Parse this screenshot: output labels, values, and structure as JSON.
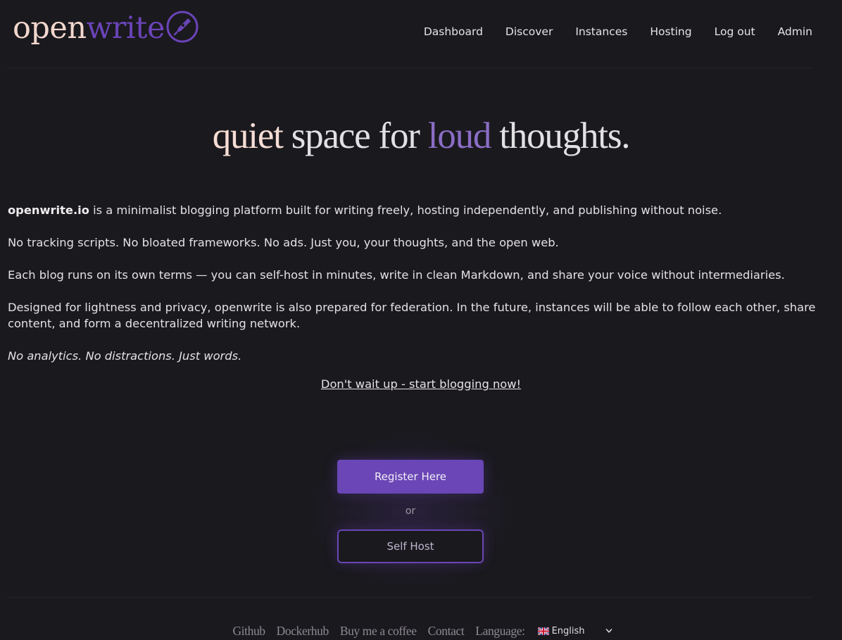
{
  "header": {
    "logo_open": "open",
    "logo_write": "write",
    "nav": [
      {
        "label": "Dashboard"
      },
      {
        "label": "Discover"
      },
      {
        "label": "Instances"
      },
      {
        "label": "Hosting"
      },
      {
        "label": "Log out"
      },
      {
        "label": "Admin"
      }
    ]
  },
  "hero": {
    "w1": "quiet",
    "w2": "space for",
    "w3": "loud",
    "w4": "thoughts."
  },
  "content": {
    "brand": "openwrite.io",
    "p1_rest": " is a minimalist blogging platform built for writing freely, hosting independently, and publishing without noise.",
    "p2": "No tracking scripts. No bloated frameworks. No ads. Just you, your thoughts, and the open web.",
    "p3": "Each blog runs on its own terms — you can self-host in minutes, write in clean Markdown, and share your voice without intermediaries.",
    "p4": "Designed for lightness and privacy, openwrite is also prepared for federation. In the future, instances will be able to follow each other, share content, and form a decentralized writing network.",
    "tagline": "No analytics. No distractions. Just words.",
    "cta": "Don't wait up - start blogging now!"
  },
  "actions": {
    "register": "Register Here",
    "or": "or",
    "self_host": "Self Host"
  },
  "footer": {
    "links": [
      {
        "label": "Github"
      },
      {
        "label": "Dockerhub"
      },
      {
        "label": "Buy me a coffee"
      },
      {
        "label": "Contact"
      }
    ],
    "language_label": "Language:",
    "language_value": "English"
  },
  "colors": {
    "background": "#1a191e",
    "accent": "#6a46b6",
    "logo_open": "#f2d7cd",
    "hero_loud": "#8a6dc5"
  },
  "icons": {
    "logo": "pen-nib-icon",
    "language_flag": "uk-flag-icon",
    "dropdown": "chevron-down-icon"
  }
}
